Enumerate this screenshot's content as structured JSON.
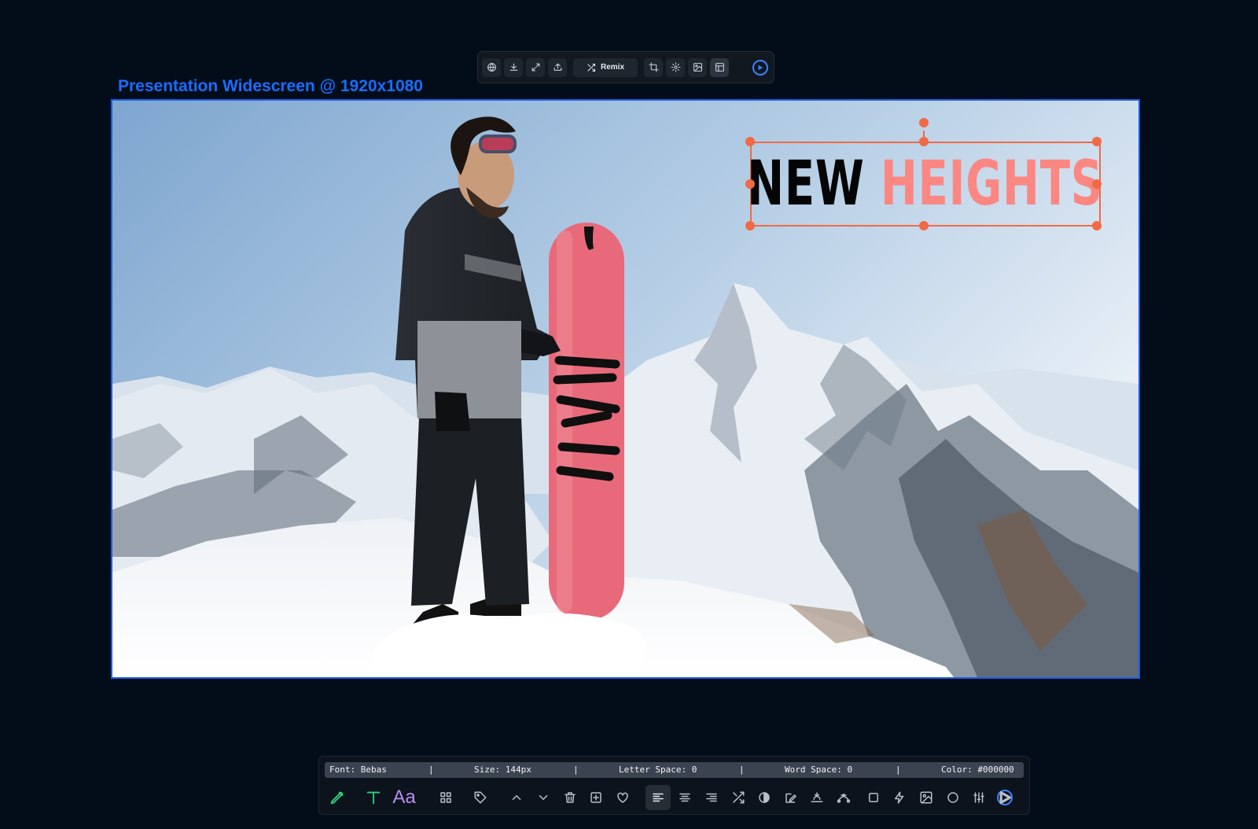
{
  "toolbar": {
    "remix_label": "Remix",
    "icons": [
      "globe-icon",
      "download-icon",
      "expand-icon",
      "upload-icon",
      "shuffle-icon",
      "crop-icon",
      "settings-icon",
      "image-icon",
      "layout-icon",
      "play-icon"
    ]
  },
  "frame": {
    "label": "Presentation Widescreen @ 1920x1080"
  },
  "headline": {
    "word1": "NEW",
    "word2": "HEIGHTS",
    "colors": {
      "word1": "#050505",
      "word2": "#fb8783",
      "selection": "#f06a45"
    }
  },
  "info_bar": {
    "font": "Font: Bebas",
    "size": "Size: 144px",
    "letter_space": "Letter Space: 0",
    "word_space": "Word Space: 0",
    "color": "Color: #000000",
    "separator": "|"
  },
  "bottom_tools": [
    "pen-icon",
    "text-icon",
    "font-icon",
    "grid-icon",
    "tag-icon",
    "chevron-up-icon",
    "chevron-down-icon",
    "trash-icon",
    "add-icon",
    "heart-icon",
    "align-left-icon",
    "align-center-icon",
    "align-right-icon",
    "shuffle-icon",
    "contrast-icon",
    "edit-image-icon",
    "horizon-icon",
    "bezier-icon",
    "square-icon",
    "lightning-icon",
    "image-icon",
    "circle-icon",
    "sliders-icon",
    "play-icon"
  ],
  "colors": {
    "background": "#030d1a",
    "accent": "#1a6dff",
    "selection": "#f06a45",
    "text_tool": "#2fd17a",
    "font_tool": "#b98cf4"
  }
}
